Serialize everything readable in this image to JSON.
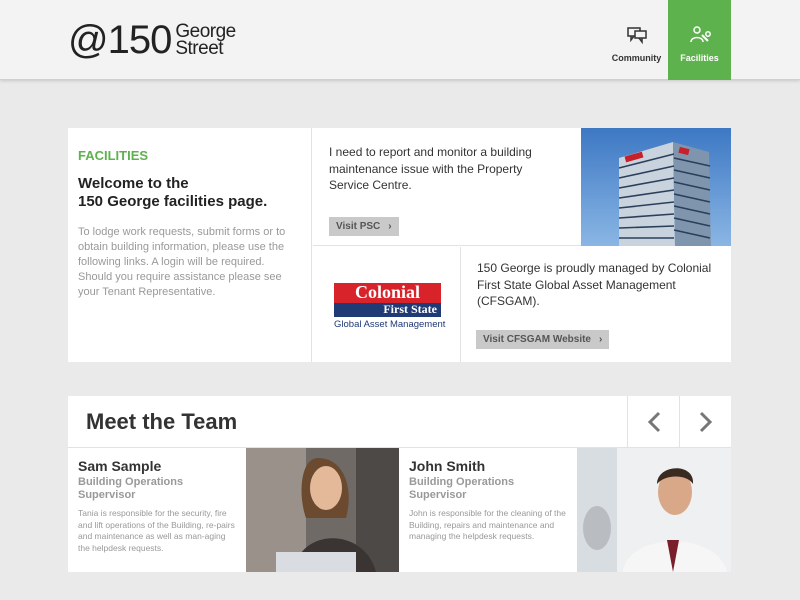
{
  "header": {
    "logo_prefix": "@150",
    "logo_word_1": "George",
    "logo_word_2": "Street",
    "nav": [
      {
        "label": "Community",
        "icon": "speech-bubbles-icon",
        "active": false
      },
      {
        "label": "Facilities",
        "icon": "wrench-person-icon",
        "active": true
      }
    ],
    "accent_color": "#5eb24d"
  },
  "facilities": {
    "eyebrow": "FACILITIES",
    "title_line_1": "Welcome to the",
    "title_line_2": "150 George facilities page.",
    "body": "To lodge work requests, submit forms or to obtain building information, please use the following links. A login will be required. Should you require assistance please see your Tenant Representative.",
    "psc_text": "I need to report and monitor a building maintenance issue with the Property Service Centre.",
    "psc_button": "Visit PSC",
    "cfs_logo": {
      "line1": "Colonial",
      "line2": "First State",
      "line3": "Global Asset Management"
    },
    "cfs_text": "150 George is proudly managed by Colonial First State Global Asset Management (CFSGAM).",
    "cfs_button": "Visit CFSGAM Website"
  },
  "team": {
    "title": "Meet the Team",
    "members": [
      {
        "name": "Sam Sample",
        "role": "Building Operations Supervisor",
        "desc": "Tania is responsible for the security, fire and lift operations of the Building, re-pairs and maintenance as well as man-aging the helpdesk requests."
      },
      {
        "name": "John Smith",
        "role": "Building Operations Supervisor",
        "desc": "John is responsible for the cleaning of the Building, repairs and maintenance and managing the helpdesk requests."
      }
    ]
  }
}
